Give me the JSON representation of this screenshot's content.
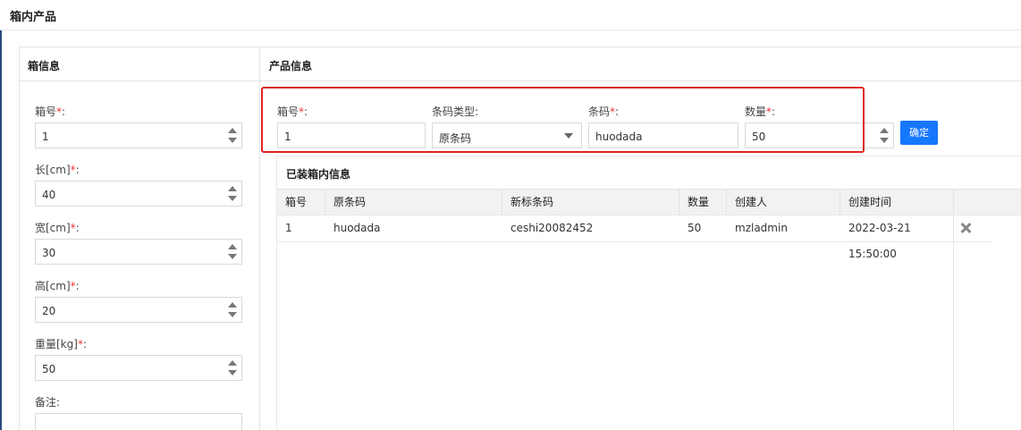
{
  "page": {
    "title": "箱内产品"
  },
  "box_info": {
    "title": "箱信息",
    "fields": [
      {
        "label": "箱号",
        "required": "*",
        "colon": ":",
        "value": "1"
      },
      {
        "label": "长[cm]",
        "required": "*",
        "colon": ":",
        "value": "40"
      },
      {
        "label": "宽[cm]",
        "required": "*",
        "colon": ":",
        "value": "30"
      },
      {
        "label": "高[cm]",
        "required": "*",
        "colon": ":",
        "value": "20"
      },
      {
        "label": "重量[kg]",
        "required": "*",
        "colon": ":",
        "value": "50"
      }
    ],
    "remark_label": "备注:"
  },
  "product_info": {
    "title": "产品信息",
    "box_no_label": "箱号",
    "box_no_value": "1",
    "barcode_type_label": "条码类型:",
    "barcode_type_value": "原条码",
    "barcode_label": "条码",
    "barcode_value": "huodada",
    "qty_label": "数量",
    "qty_value": "50",
    "required": "*",
    "colon": ":",
    "confirm_label": "确定"
  },
  "packed": {
    "title": "已装箱内信息",
    "columns": [
      "箱号",
      "原条码",
      "新标条码",
      "数量",
      "创建人",
      "创建时间"
    ],
    "rows": [
      [
        "1",
        "huodada",
        "ceshi20082452",
        "50",
        "mzladmin",
        "2022-03-21 15:50:00"
      ]
    ]
  },
  "colors": {
    "primary": "#1677ff",
    "highlight_frame": "#e02424",
    "required": "#ee3333"
  },
  "icons": {
    "delete": "close-x-icon",
    "spinner": "spinner-arrows-icon",
    "select": "chevron-down-icon"
  }
}
